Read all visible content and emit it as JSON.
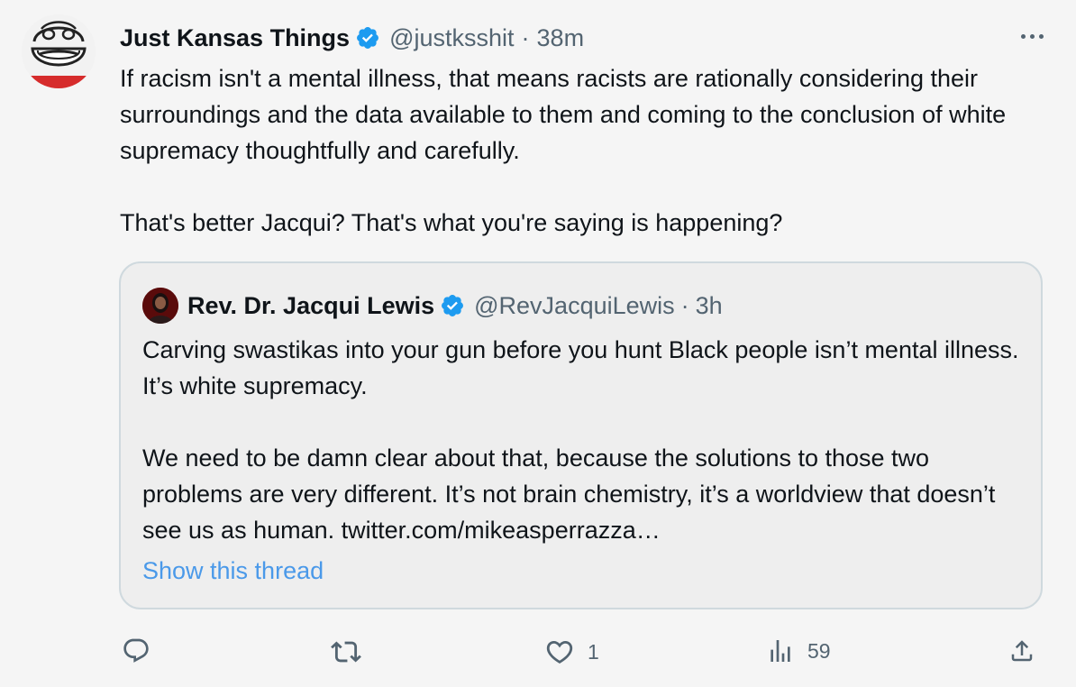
{
  "tweet": {
    "display_name": "Just Kansas Things",
    "handle": "@justksshit",
    "separator": "·",
    "time": "38m",
    "paragraphs": [
      "If racism isn't a mental illness, that means racists are rationally considering their surroundings and the data available to them and coming to the conclusion of white supremacy thoughtfully and carefully.",
      "That's better Jacqui? That's what you're saying is happening?"
    ]
  },
  "quote": {
    "display_name": "Rev. Dr. Jacqui Lewis",
    "handle": "@RevJacquiLewis",
    "separator": "·",
    "time": "3h",
    "paragraphs": [
      "Carving swastikas into your gun before you hunt Black people isn’t mental illness. It’s white supremacy.",
      "We need to be damn clear about that, because the solutions to those two problems are very different. It’s not brain chemistry, it’s a worldview that doesn’t see us as human. twitter.com/mikeasperrazza…"
    ],
    "show_thread": "Show this thread"
  },
  "actions": {
    "reply_icon": "reply-icon",
    "retweet_icon": "retweet-icon",
    "like_icon": "heart-icon",
    "like_count": "1",
    "views_icon": "views-icon",
    "views_count": "59",
    "share_icon": "share-icon"
  },
  "colors": {
    "background": "#f5f5f5",
    "text": "#0f1419",
    "secondary": "#536471",
    "link": "#4a99e9",
    "verified": "#1d9bf0",
    "quote_border": "#cfd9de"
  }
}
